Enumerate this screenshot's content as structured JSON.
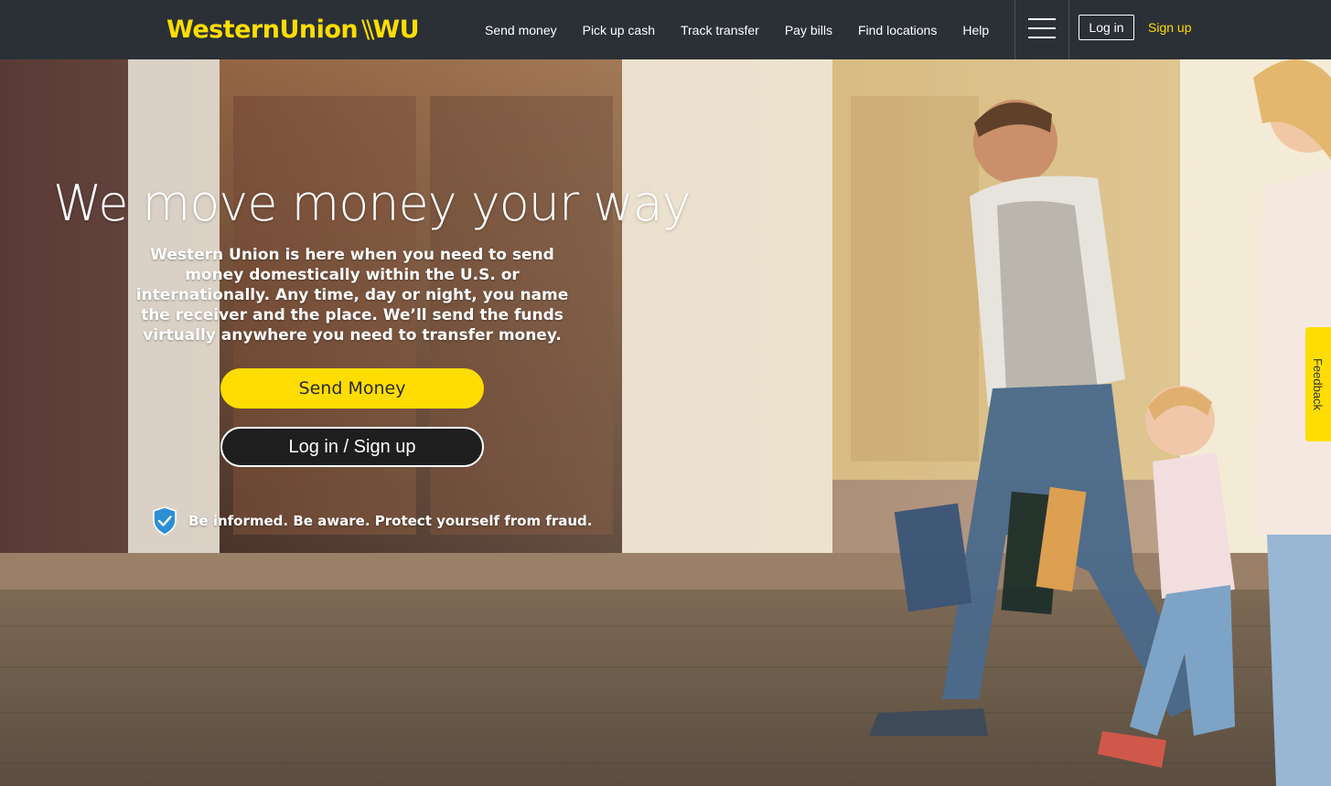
{
  "brand": {
    "name_main": "WesternUnion",
    "name_mark": "WU",
    "accent_color": "#ffdd00"
  },
  "nav": {
    "links": [
      {
        "label": "Send money"
      },
      {
        "label": "Pick up cash"
      },
      {
        "label": "Track transfer"
      },
      {
        "label": "Pay bills"
      },
      {
        "label": "Find locations"
      },
      {
        "label": "Help"
      }
    ],
    "menu_icon": "hamburger-menu-icon",
    "login_label": "Log in",
    "signup_label": "Sign up"
  },
  "hero": {
    "title": "We move money your way",
    "description": "Western Union is here when you need to send money domestically within the U.S. or internationally. Any time, day or night, you name the receiver and the place. We’ll send the funds virtually anywhere you need to transfer money.",
    "primary_cta": "Send Money",
    "secondary_cta": "Log in / Sign up",
    "fraud_icon": "shield-check-icon",
    "fraud_notice": "Be informed. Be aware. Protect yourself from fraud."
  },
  "feedback": {
    "label": "Feedback"
  }
}
